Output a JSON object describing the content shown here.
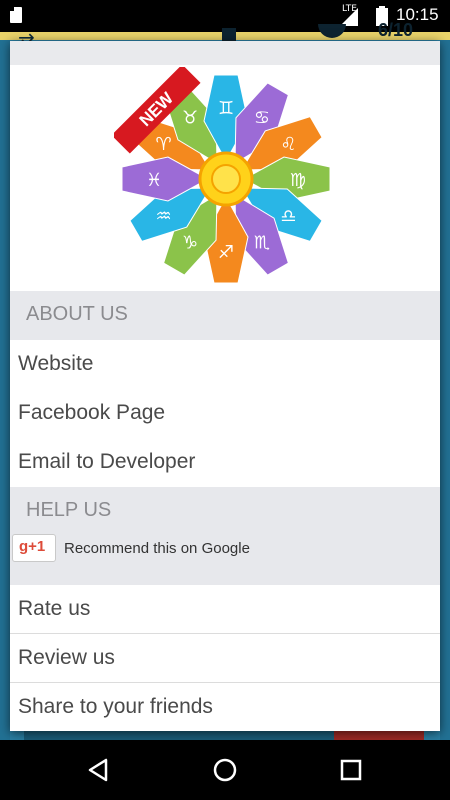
{
  "status_bar": {
    "network": "LTE",
    "time": "10:15"
  },
  "background_app": {
    "score": "6/10"
  },
  "dialog": {
    "logo": {
      "badge": "NEW"
    },
    "about_section": {
      "header": "ABOUT US",
      "items": [
        {
          "label": "Website"
        },
        {
          "label": "Facebook Page"
        },
        {
          "label": "Email to Developer"
        }
      ]
    },
    "help_section": {
      "header": "HELP US",
      "gplus_label": "g+1",
      "gplus_text": "Recommend this on Google",
      "items": [
        {
          "label": "Rate us"
        },
        {
          "label": "Review us"
        },
        {
          "label": "Share to your friends"
        }
      ]
    }
  },
  "nav_bar": {
    "icons": [
      "back-icon",
      "home-icon",
      "recents-icon"
    ]
  },
  "colors": {
    "section_header_bg": "#e7e8ec",
    "section_header_text": "#8b8b8f",
    "item_text": "#4a4a4a",
    "gplus_red": "#dd4b39",
    "badge_red": "#d71920"
  }
}
